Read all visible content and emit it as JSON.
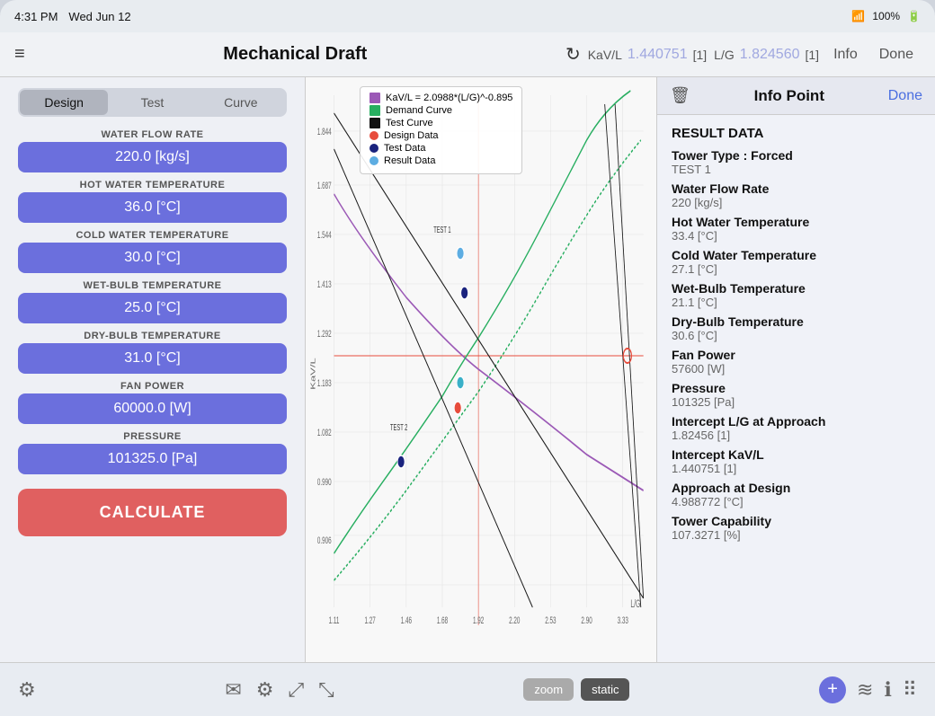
{
  "statusBar": {
    "time": "4:31 PM",
    "date": "Wed Jun 12",
    "wifi": "wifi",
    "battery": "100%"
  },
  "navBar": {
    "menuIcon": "≡",
    "title": "Mechanical Draft",
    "refreshIcon": "↻",
    "kavLabel": "KaV/L",
    "kavValue": "1.440751",
    "kavUnit": "[1]",
    "lgLabel": "L/G",
    "lgValue": "1.824560",
    "lgUnit": "[1]",
    "infoLabel": "Info",
    "doneLabel": "Done"
  },
  "tabs": {
    "items": [
      "Design",
      "Test",
      "Curve"
    ],
    "active": 0
  },
  "fields": [
    {
      "label": "WATER FLOW RATE",
      "value": "220.0 [kg/s]"
    },
    {
      "label": "HOT WATER TEMPERATURE",
      "value": "36.0 [°C]"
    },
    {
      "label": "COLD WATER TEMPERATURE",
      "value": "30.0 [°C]"
    },
    {
      "label": "WET-BULB TEMPERATURE",
      "value": "25.0 [°C]"
    },
    {
      "label": "DRY-BULB TEMPERATURE",
      "value": "31.0 [°C]"
    },
    {
      "label": "FAN POWER",
      "value": "60000.0 [W]"
    },
    {
      "label": "PRESSURE",
      "value": "101325.0 [Pa]"
    }
  ],
  "calculateBtn": "CALCULATE",
  "chart": {
    "yLabel": "KaV/L",
    "xLabel": "L/G",
    "yTicks": [
      "1.844",
      "1.687",
      "1.544",
      "1.413",
      "1.292",
      "1.183",
      "1.082",
      "0.990",
      "0.906"
    ],
    "xTicks": [
      "1.11",
      "1.27",
      "1.46",
      "1.68",
      "1.92",
      "2.20",
      "2.53",
      "2.90",
      "3.33"
    ],
    "equationLabel": "KaV/L = 2.0988*(L/G)^-0.895",
    "legend": [
      {
        "type": "square",
        "color": "#9b59b6",
        "label": "KaV/L = 2.0988*(L/G)^-0.895"
      },
      {
        "type": "square",
        "color": "#27ae60",
        "label": "Demand Curve"
      },
      {
        "type": "square",
        "color": "#111",
        "label": "Test Curve"
      },
      {
        "type": "dot",
        "color": "#e74c3c",
        "label": "Design Data"
      },
      {
        "type": "dot",
        "color": "#2c3e80",
        "label": "Test Data"
      },
      {
        "type": "dot",
        "color": "#5dade2",
        "label": "Result Data"
      }
    ],
    "testLabels": [
      "TEST 1",
      "TEST 2"
    ]
  },
  "infoPanel": {
    "title": "Info Point",
    "doneLabel": "Done",
    "resultTitle": "RESULT DATA",
    "rows": [
      {
        "label": "Tower Type : Forced",
        "value": "TEST 1"
      },
      {
        "label": "Water Flow Rate",
        "value": "220 [kg/s]"
      },
      {
        "label": "Hot Water Temperature",
        "value": "33.4 [°C]"
      },
      {
        "label": "Cold Water Temperature",
        "value": "27.1 [°C]"
      },
      {
        "label": "Wet-Bulb Temperature",
        "value": "21.1 [°C]"
      },
      {
        "label": "Dry-Bulb Temperature",
        "value": "30.6 [°C]"
      },
      {
        "label": "Fan Power",
        "value": "57600 [W]"
      },
      {
        "label": "Pressure",
        "value": "101325 [Pa]"
      },
      {
        "label": "Intercept L/G at Approach",
        "value": "1.82456 [1]"
      },
      {
        "label": "Intercept KaV/L",
        "value": "1.440751 [1]"
      },
      {
        "label": "Approach at Design",
        "value": "4.988772 [°C]"
      },
      {
        "label": "Tower Capability",
        "value": "107.3271 [%]"
      }
    ]
  },
  "bottomBar": {
    "mailIcon": "✉",
    "settingsIcon": "⚙",
    "expandIcon": "⤢",
    "collapseIcon": "⤡",
    "zoomLabel": "zoom",
    "staticLabel": "static",
    "addIcon": "+",
    "wavesIcon": "≋",
    "infoIcon": "ℹ",
    "gridIcon": "⠿"
  }
}
